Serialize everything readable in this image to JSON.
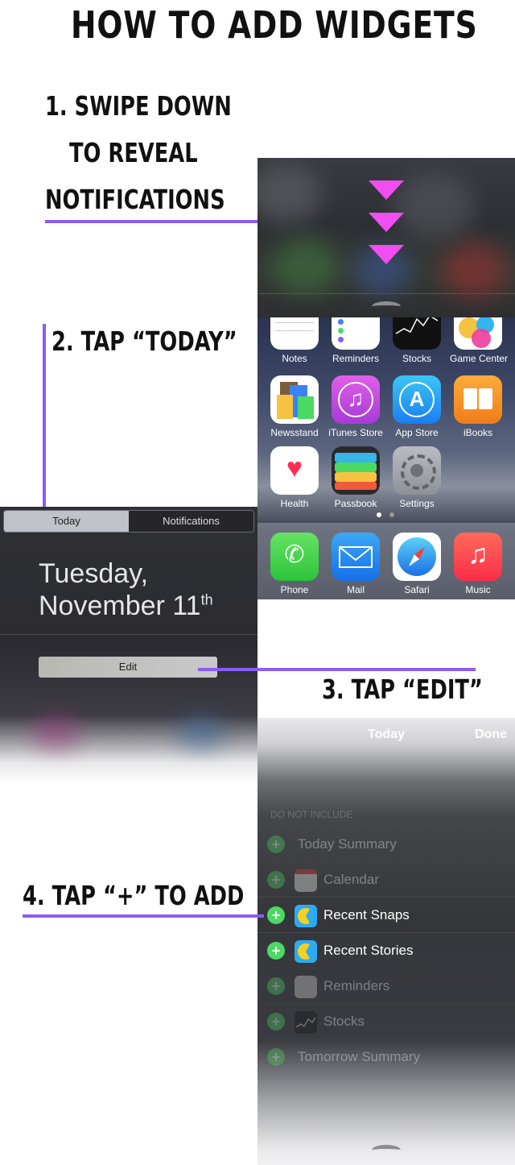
{
  "title": "HOW TO ADD WIDGETS",
  "steps": {
    "step1_line1": "1. SWIPE DOWN",
    "step1_line2": "TO REVEAL",
    "step1_line3": "NOTIFICATIONS",
    "step2": "2. TAP “TODAY”",
    "step3": "3. TAP “EDIT”",
    "step4": "4. TAP “+” TO ADD"
  },
  "colors": {
    "accent_line": "#8a5cf5",
    "arrow": "#f04ef0",
    "add_green": "#4cd964"
  },
  "home_apps": [
    {
      "label": "Notes",
      "icon": "notes-icon"
    },
    {
      "label": "Reminders",
      "icon": "reminders-icon"
    },
    {
      "label": "Stocks",
      "icon": "stocks-icon"
    },
    {
      "label": "Game Center",
      "icon": "game-center-icon"
    },
    {
      "label": "Newsstand",
      "icon": "newsstand-icon"
    },
    {
      "label": "iTunes Store",
      "icon": "itunes-store-icon"
    },
    {
      "label": "App Store",
      "icon": "app-store-icon"
    },
    {
      "label": "iBooks",
      "icon": "ibooks-icon"
    },
    {
      "label": "Health",
      "icon": "health-icon"
    },
    {
      "label": "Passbook",
      "icon": "passbook-icon"
    },
    {
      "label": "Settings",
      "icon": "settings-icon"
    }
  ],
  "dock_apps": [
    {
      "label": "Phone",
      "icon": "phone-icon"
    },
    {
      "label": "Mail",
      "icon": "mail-icon"
    },
    {
      "label": "Safari",
      "icon": "safari-icon"
    },
    {
      "label": "Music",
      "icon": "music-icon"
    }
  ],
  "today_panel": {
    "tab_today": "Today",
    "tab_notifications": "Notifications",
    "date_line1": "Tuesday,",
    "date_line2": "November 11",
    "date_suffix": "th",
    "edit_button": "Edit"
  },
  "edit_list": {
    "title": "Today",
    "done": "Done",
    "section_header": "DO NOT INCLUDE",
    "items": [
      {
        "label": "Today Summary"
      },
      {
        "label": "Calendar"
      },
      {
        "label": "Recent Snaps"
      },
      {
        "label": "Recent Stories"
      },
      {
        "label": "Reminders"
      },
      {
        "label": "Stocks"
      },
      {
        "label": "Tomorrow Summary"
      }
    ]
  }
}
